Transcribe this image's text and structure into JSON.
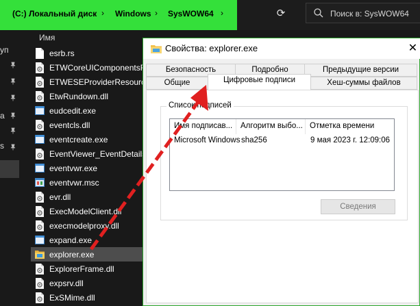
{
  "explorer": {
    "breadcrumb": [
      "(C:) Локальный диск",
      "Windows",
      "SysWOW64"
    ],
    "search_placeholder": "Поиск в: SysWOW64",
    "column_header": "Имя",
    "files": [
      {
        "name": "esrb.rs",
        "icon": "file-icon"
      },
      {
        "name": "ETWCoreUIComponentsResources.dll",
        "icon": "dll-icon"
      },
      {
        "name": "ETWESEProviderResources.dll",
        "icon": "dll-icon"
      },
      {
        "name": "EtwRundown.dll",
        "icon": "dll-icon"
      },
      {
        "name": "eudcedit.exe",
        "icon": "exe-icon"
      },
      {
        "name": "eventcls.dll",
        "icon": "dll-icon"
      },
      {
        "name": "eventcreate.exe",
        "icon": "exe-icon"
      },
      {
        "name": "EventViewer_EventDetails.dll",
        "icon": "dll-icon"
      },
      {
        "name": "eventvwr.exe",
        "icon": "exe-icon"
      },
      {
        "name": "eventvwr.msc",
        "icon": "msc-icon"
      },
      {
        "name": "evr.dll",
        "icon": "dll-icon"
      },
      {
        "name": "ExecModelClient.dll",
        "icon": "dll-icon"
      },
      {
        "name": "execmodelproxy.dll",
        "icon": "dll-icon"
      },
      {
        "name": "expand.exe",
        "icon": "exe-icon"
      },
      {
        "name": "explorer.exe",
        "icon": "folder-app-icon",
        "selected": true
      },
      {
        "name": "ExplorerFrame.dll",
        "icon": "dll-icon"
      },
      {
        "name": "expsrv.dll",
        "icon": "dll-icon"
      },
      {
        "name": "ExSMime.dll",
        "icon": "dll-icon"
      }
    ],
    "nav_fragments": [
      "уп",
      "",
      "",
      "",
      "а",
      "",
      "s",
      "",
      ""
    ]
  },
  "dialog": {
    "title": "Свойства: explorer.exe",
    "tabs_row1": [
      "Безопасность",
      "Подробно",
      "Предыдущие версии"
    ],
    "tabs_row2": [
      "Общие",
      "Цифровые подписи",
      "Хеш-суммы файлов"
    ],
    "active_tab": "Цифровые подписи",
    "group_label": "Список подписей",
    "columns": [
      "Имя подписав...",
      "Алгоритм выбо...",
      "Отметка времени"
    ],
    "rows": [
      {
        "signer": "Microsoft Windows",
        "algorithm": "sha256",
        "timestamp": "9 мая 2023 г. 12:09:06"
      }
    ],
    "details_button": "Сведения"
  },
  "colors": {
    "breadcrumb_highlight": "#34e03a",
    "arrow": "#e02020",
    "dialog_border": "#2aa52a"
  }
}
